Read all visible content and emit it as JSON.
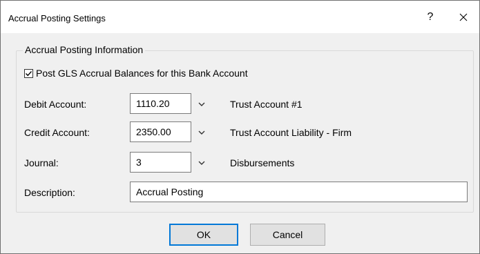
{
  "window": {
    "title": "Accrual Posting Settings",
    "help_label": "?"
  },
  "group": {
    "label": "Accrual Posting Information"
  },
  "post_checkbox": {
    "label": "Post GLS Accrual Balances for this Bank Account",
    "checked": true
  },
  "debit": {
    "label": "Debit Account:",
    "value": "1110.20",
    "name": "Trust Account #1"
  },
  "credit": {
    "label": "Credit Account:",
    "value": "2350.00",
    "name": "Trust Account Liability - Firm"
  },
  "journal": {
    "label": "Journal:",
    "value": "3",
    "name": "Disbursements"
  },
  "description": {
    "label": "Description:",
    "value": "Accrual Posting"
  },
  "buttons": {
    "ok": "OK",
    "cancel": "Cancel"
  },
  "colors": {
    "default_button_border": "#0078d7"
  }
}
